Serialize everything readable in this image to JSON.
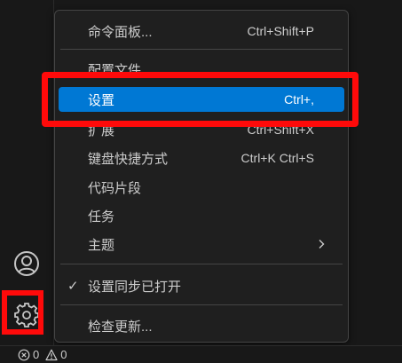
{
  "menu": {
    "items": [
      {
        "label": "命令面板...",
        "shortcut": "Ctrl+Shift+P"
      },
      {
        "label": "配置文件",
        "shortcut": ""
      },
      {
        "label": "设置",
        "shortcut": "Ctrl+,"
      },
      {
        "label": "扩展",
        "shortcut": "Ctrl+Shift+X"
      },
      {
        "label": "键盘快捷方式",
        "shortcut": "Ctrl+K Ctrl+S"
      },
      {
        "label": "代码片段",
        "shortcut": ""
      },
      {
        "label": "任务",
        "shortcut": ""
      },
      {
        "label": "主题",
        "shortcut": "",
        "submenu": true
      },
      {
        "label": "设置同步已打开",
        "check": "✓"
      },
      {
        "label": "检查更新..."
      }
    ]
  },
  "status_bar": {
    "errors": "0",
    "warnings": "0"
  },
  "colors": {
    "selection": "#0078d4",
    "highlight_box": "#ff0a0a",
    "menu_background": "#1f1f1f",
    "window_background": "#181818"
  },
  "icons": [
    "account-icon",
    "gear-icon",
    "chevron-right-icon",
    "check-icon",
    "error-icon",
    "warning-icon"
  ]
}
